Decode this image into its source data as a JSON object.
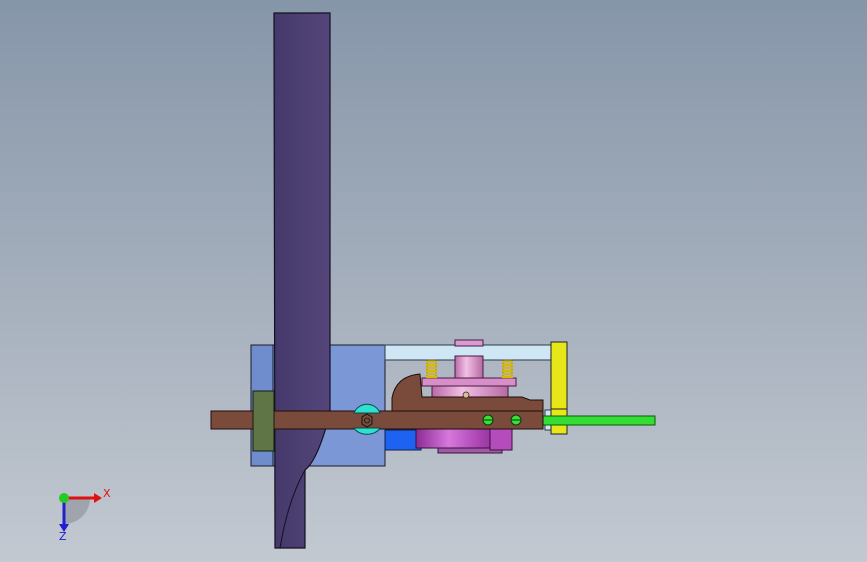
{
  "triad": {
    "x_label": "X",
    "z_label": "Z",
    "x_color": "#e01010",
    "y_color": "#22cc22",
    "z_color": "#2020d0"
  },
  "colors": {
    "background_top": "#8696a9",
    "background_bottom": "#c3c9d1",
    "plate": "#4f4171",
    "housing": "#7b97d6",
    "arm": "#7a4a3a",
    "collar": "#5f7545",
    "yellow_bracket": "#e6e619",
    "light_blue_bar": "#cfe6f5",
    "green_rod": "#33dd33",
    "blue_block": "#1e62f2",
    "motor": "#c05ac8",
    "pink_shaft": "#e7a7d8",
    "spring": "#d9b800"
  }
}
